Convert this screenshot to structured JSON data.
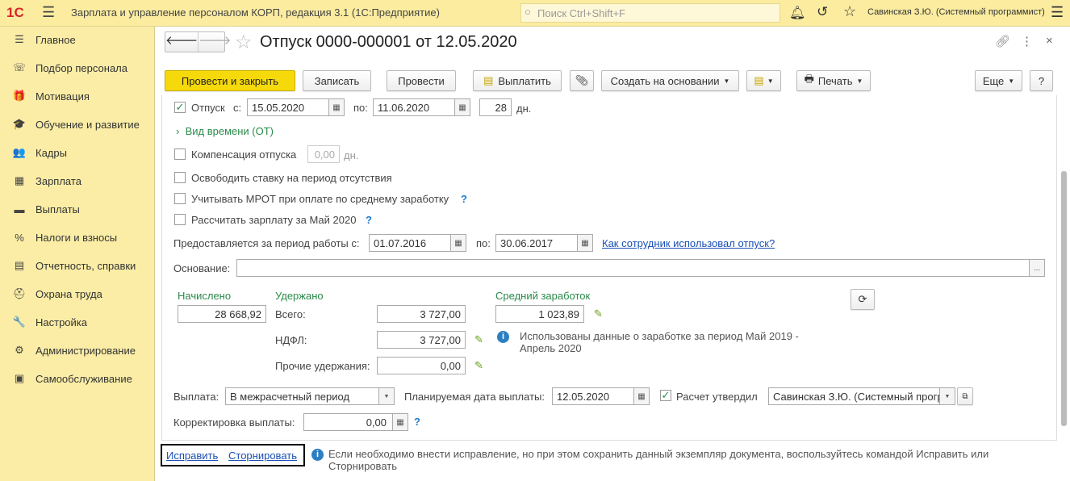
{
  "topbar": {
    "logo": "1С",
    "title": "Зарплата и управление персоналом КОРП, редакция 3.1  (1С:Предприятие)",
    "search_placeholder": "Поиск Ctrl+Shift+F",
    "user": "Савинская З.Ю. (Системный программист)"
  },
  "sidebar": {
    "items": [
      {
        "label": "Главное",
        "icon": "☰"
      },
      {
        "label": "Подбор персонала",
        "icon": "☏"
      },
      {
        "label": "Мотивация",
        "icon": "🎁"
      },
      {
        "label": "Обучение и развитие",
        "icon": "🎓"
      },
      {
        "label": "Кадры",
        "icon": "👥"
      },
      {
        "label": "Зарплата",
        "icon": "▦"
      },
      {
        "label": "Выплаты",
        "icon": "▬"
      },
      {
        "label": "Налоги и взносы",
        "icon": "%"
      },
      {
        "label": "Отчетность, справки",
        "icon": "▤"
      },
      {
        "label": "Охрана труда",
        "icon": "⛑"
      },
      {
        "label": "Настройка",
        "icon": "🔧"
      },
      {
        "label": "Администрирование",
        "icon": "⚙"
      },
      {
        "label": "Самообслуживание",
        "icon": "▣"
      }
    ]
  },
  "doc": {
    "title": "Отпуск 0000-000001 от 12.05.2020"
  },
  "toolbar": {
    "post_close": "Провести и закрыть",
    "save": "Записать",
    "post": "Провести",
    "pay": "Выплатить",
    "create_based": "Создать на основании",
    "print": "Печать",
    "more": "Еще",
    "help": "?"
  },
  "form": {
    "vacation_label": "Отпуск",
    "vacation_checked": true,
    "from_label": "с:",
    "from": "15.05.2020",
    "to_label": "по:",
    "to": "11.06.2020",
    "days": "28",
    "days_unit": "дн.",
    "time_kind": "Вид времени (ОТ)",
    "compensation_label": "Компенсация отпуска",
    "compensation_value": "0,00",
    "compensation_unit": "дн.",
    "free_rate": "Освободить ставку на период отсутствия",
    "mrot": "Учитывать МРОТ при оплате по среднему заработку",
    "calc_salary": "Рассчитать зарплату за Май 2020",
    "q": "?",
    "period_label": "Предоставляется за период работы с:",
    "period_from": "01.07.2016",
    "period_to_label": "по:",
    "period_to": "30.06.2017",
    "usage_link": "Как сотрудник использовал отпуск?",
    "basis_label": "Основание:",
    "basis_value": "",
    "basis_btn": "...",
    "accrued_label": "Начислено",
    "accrued": "28 668,92",
    "withheld_label": "Удержано",
    "total_label": "Всего:",
    "total": "3 727,00",
    "ndfl_label": "НДФЛ:",
    "ndfl": "3 727,00",
    "other_label": "Прочие удержания:",
    "other": "0,00",
    "avg_label": "Средний заработок",
    "avg": "1 023,89",
    "avg_info": "Использованы данные о заработке за период Май 2019 - Апрель 2020",
    "payment_label": "Выплата:",
    "payment": "В межрасчетный период",
    "plan_date_label": "Планируемая дата выплаты:",
    "plan_date": "12.05.2020",
    "approved_label": "Расчет утвердил",
    "approved_checked": true,
    "approved_by": "Савинская З.Ю. (Системный программист)",
    "adjust_label": "Корректировка выплаты:",
    "adjust": "0,00"
  },
  "footer": {
    "fix": "Исправить",
    "storno": "Сторнировать",
    "info": "Если необходимо внести исправление, но при этом сохранить данный экземпляр документа, воспользуйтесь командой Исправить или Сторнировать"
  }
}
